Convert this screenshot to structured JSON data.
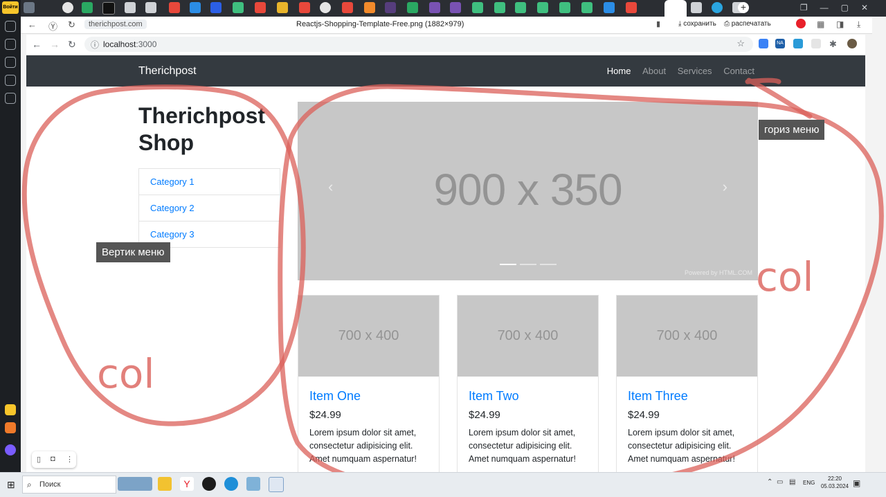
{
  "yandex": {
    "login_label": "Войти",
    "host": "therichpost.com",
    "tab_title": "Reactjs-Shopping-Template-Free.png (1882×979)",
    "save_label": "сохранить",
    "print_label": "распечатать"
  },
  "chrome": {
    "url_host": "localhost",
    "url_port": ":3000",
    "ext_badge": "NA"
  },
  "page": {
    "brand": "Therichpost",
    "nav": [
      "Home",
      "About",
      "Services",
      "Contact"
    ],
    "title": "Therichpost Shop",
    "categories": [
      "Category 1",
      "Category 2",
      "Category 3"
    ],
    "carousel": {
      "text": "900 x 350",
      "powered": "Powered by HTML.COM",
      "prev": "‹",
      "next": "›"
    },
    "cards": [
      {
        "img": "700 x 400",
        "title": "Item One",
        "price": "$24.99",
        "desc": "Lorem ipsum dolor sit amet, consectetur adipisicing elit. Amet numquam aspernatur!"
      },
      {
        "img": "700 x 400",
        "title": "Item Two",
        "price": "$24.99",
        "desc": "Lorem ipsum dolor sit amet, consectetur adipisicing elit. Amet numquam aspernatur!"
      },
      {
        "img": "700 x 400",
        "title": "Item Three",
        "price": "$24.99",
        "desc": "Lorem ipsum dolor sit amet, consectetur adipisicing elit. Amet numquam aspernatur!"
      }
    ]
  },
  "annotations": {
    "horizontal_menu": "гориз меню",
    "vertical_menu": "Вертик меню",
    "col_left": "col",
    "col_right": "col",
    "stroke_color": "#db605a"
  },
  "taskbar": {
    "search_label": "Поиск",
    "lang": "ENG",
    "time": "22:20",
    "date": "05.03.2024"
  }
}
